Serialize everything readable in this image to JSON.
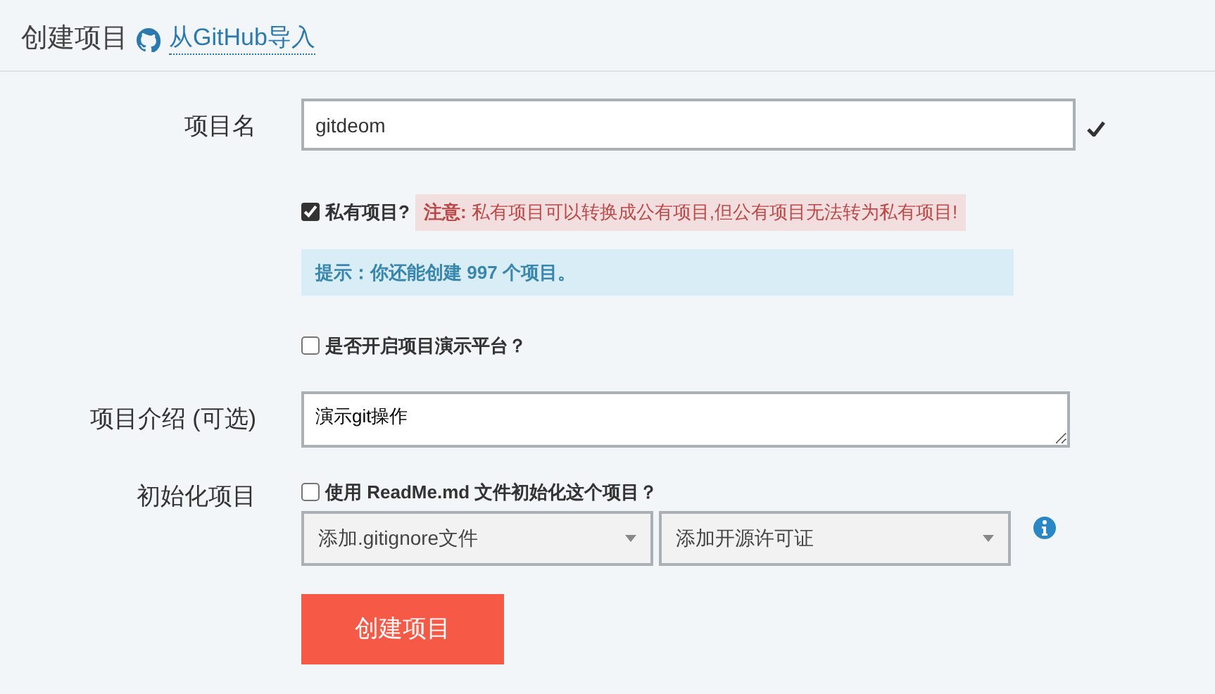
{
  "header": {
    "title": "创建项目",
    "import_link": "从GitHub导入"
  },
  "name_field": {
    "label": "项目名",
    "value": "gitdeom",
    "valid": true
  },
  "private": {
    "label": "私有项目?",
    "checked": true,
    "warning_prefix": "注意:",
    "warning": "私有项目可以转换成公有项目,但公有项目无法转为私有项目!"
  },
  "hint": "提示：你还能创建 997 个项目。",
  "demo": {
    "label": "是否开启项目演示平台？",
    "checked": false
  },
  "description_field": {
    "label": "项目介绍 (可选)",
    "value": "演示git操作"
  },
  "init": {
    "label": "初始化项目",
    "readme_label": "使用 ReadMe.md 文件初始化这个项目？",
    "readme_checked": false,
    "selects": [
      {
        "value": "添加.gitignore文件"
      },
      {
        "value": "添加开源许可证"
      }
    ]
  },
  "submit": "创建项目"
}
